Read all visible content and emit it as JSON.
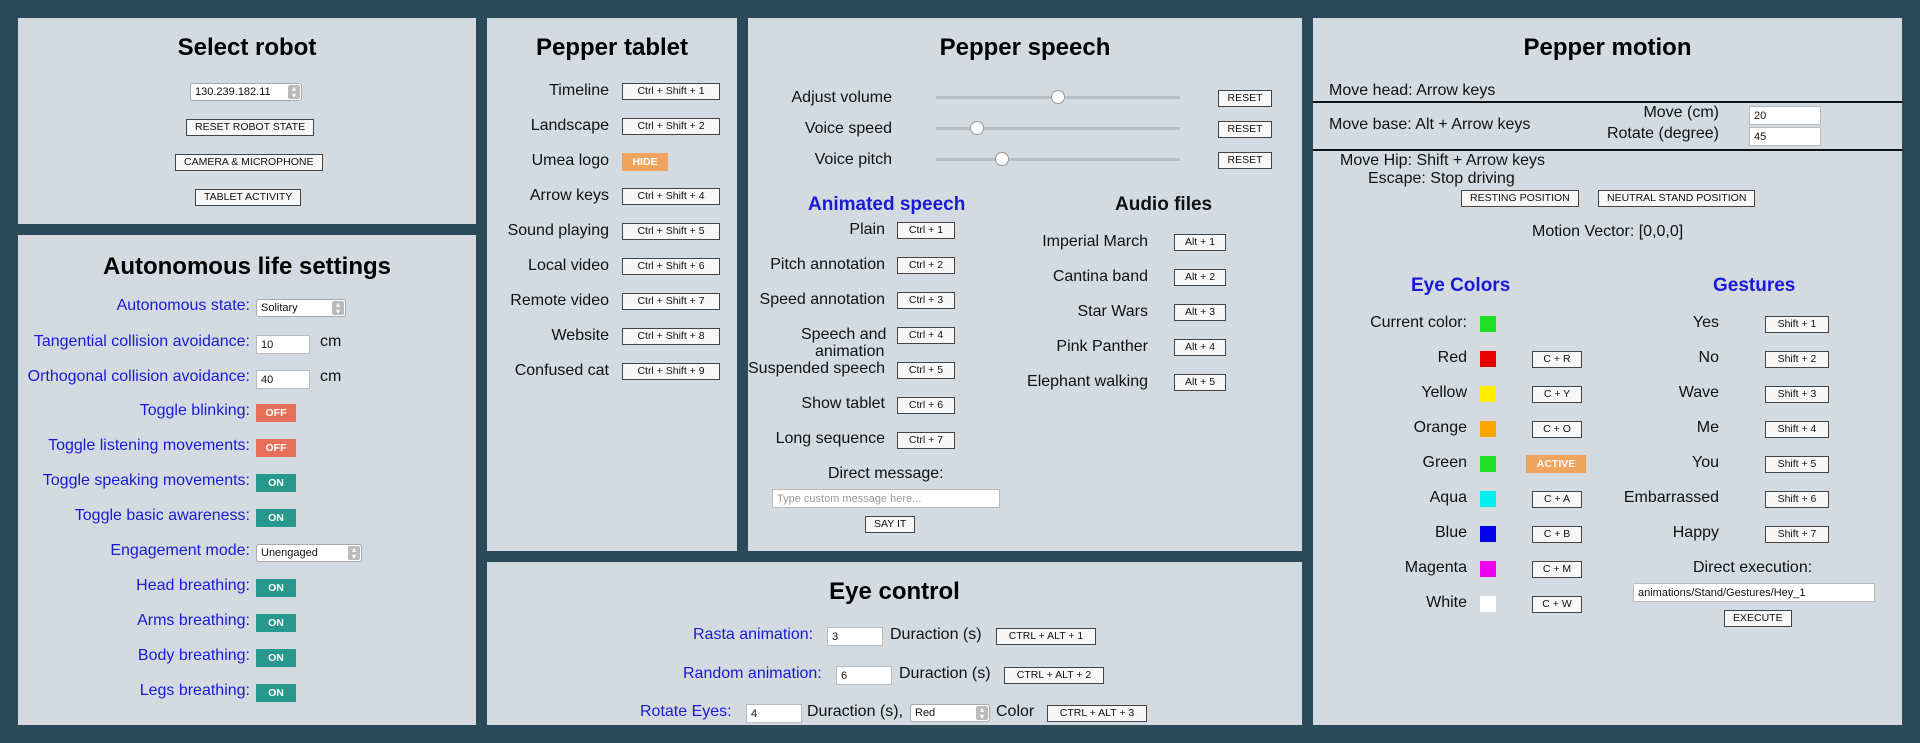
{
  "select_robot": {
    "title": "Select robot",
    "ip": "130.239.182.11",
    "buttons": [
      "RESET ROBOT STATE",
      "CAMERA & MICROPHONE",
      "TABLET ACTIVITY"
    ]
  },
  "autonomous": {
    "title": "Autonomous life settings",
    "state_label": "Autonomous state:",
    "state_value": "Solitary",
    "tangential_label": "Tangential collision avoidance:",
    "tangential_value": "10",
    "orthogonal_label": "Orthogonal collision avoidance:",
    "orthogonal_value": "40",
    "unit": "cm",
    "toggles": [
      {
        "label": "Toggle blinking:",
        "state": "OFF"
      },
      {
        "label": "Toggle listening movements:",
        "state": "OFF"
      },
      {
        "label": "Toggle speaking movements:",
        "state": "ON"
      },
      {
        "label": "Toggle basic awareness:",
        "state": "ON"
      }
    ],
    "engagement_label": "Engagement mode:",
    "engagement_value": "Unengaged",
    "breathing": [
      {
        "label": "Head breathing:",
        "state": "ON"
      },
      {
        "label": "Arms breathing:",
        "state": "ON"
      },
      {
        "label": "Body breathing:",
        "state": "ON"
      },
      {
        "label": "Legs breathing:",
        "state": "ON"
      }
    ]
  },
  "tablet": {
    "title": "Pepper tablet",
    "items": [
      {
        "label": "Timeline",
        "key": "Ctrl + Shift + 1"
      },
      {
        "label": "Landscape",
        "key": "Ctrl + Shift + 2"
      },
      {
        "label": "Umea logo",
        "key": "HIDE"
      },
      {
        "label": "Arrow keys",
        "key": "Ctrl + Shift + 4"
      },
      {
        "label": "Sound playing",
        "key": "Ctrl + Shift + 5"
      },
      {
        "label": "Local video",
        "key": "Ctrl + Shift + 6"
      },
      {
        "label": "Remote video",
        "key": "Ctrl + Shift + 7"
      },
      {
        "label": "Website",
        "key": "Ctrl + Shift + 8"
      },
      {
        "label": "Confused cat",
        "key": "Ctrl + Shift + 9"
      }
    ]
  },
  "speech": {
    "title": "Pepper speech",
    "sliders": [
      {
        "label": "Adjust volume",
        "value": 0.5,
        "reset": "RESET"
      },
      {
        "label": "Voice speed",
        "value": 0.17,
        "reset": "RESET"
      },
      {
        "label": "Voice pitch",
        "value": 0.27,
        "reset": "RESET"
      }
    ],
    "animated_title": "Animated speech",
    "animated": [
      {
        "label": "Plain",
        "key": "Ctrl + 1"
      },
      {
        "label": "Pitch annotation",
        "key": "Ctrl + 2"
      },
      {
        "label": "Speed annotation",
        "key": "Ctrl + 3"
      },
      {
        "label": "Speech and",
        "label2": "animation",
        "key": "Ctrl + 4"
      },
      {
        "label": "Suspended speech",
        "key": "Ctrl + 5"
      },
      {
        "label": "Show tablet",
        "key": "Ctrl + 6"
      },
      {
        "label": "Long sequence",
        "key": "Ctrl + 7"
      }
    ],
    "audio_title": "Audio files",
    "audio": [
      {
        "label": "Imperial March",
        "key": "Alt + 1"
      },
      {
        "label": "Cantina band",
        "key": "Alt + 2"
      },
      {
        "label": "Star Wars",
        "key": "Alt + 3"
      },
      {
        "label": "Pink Panther",
        "key": "Alt + 4"
      },
      {
        "label": "Elephant walking",
        "key": "Alt + 5"
      }
    ],
    "direct_label": "Direct message:",
    "direct_placeholder": "Type custom message here...",
    "say_button": "SAY IT"
  },
  "eye": {
    "title": "Eye control",
    "rasta_label": "Rasta animation:",
    "rasta_value": "3",
    "random_label": "Random animation:",
    "random_value": "6",
    "rotate_label": "Rotate Eyes:",
    "rotate_value": "4",
    "duration_label": "Duraction (s)",
    "duration_label2": "Duraction (s),",
    "rotate_color": "Red",
    "color_label": "Color",
    "keys": [
      "CTRL + ALT + 1",
      "CTRL + ALT + 2",
      "CTRL + ALT + 3"
    ]
  },
  "motion": {
    "title": "Pepper motion",
    "move_head_label": "Move head",
    "move_head_value": "Arrow keys",
    "move_base_label": "Move base",
    "move_base_value": "Alt + Arrow keys",
    "move_cm_label": "Move (cm)",
    "move_cm_value": "20",
    "rotate_label": "Rotate (degree)",
    "rotate_value": "45",
    "move_hip_label": "Move Hip",
    "move_hip_value": "Shift + Arrow keys",
    "escape_label": "Escape",
    "escape_value": "Stop driving",
    "resting_button": "RESTING POSITION",
    "neutral_button": "NEUTRAL STAND POSITION",
    "motion_vector": "Motion Vector: [0,0,0]",
    "eye_colors_title": "Eye Colors",
    "current_color_label": "Current color:",
    "current_color": "#22dd22",
    "colors": [
      {
        "label": "Red",
        "hex": "#e80000",
        "key": "C + R"
      },
      {
        "label": "Yellow",
        "hex": "#ffee00",
        "key": "C + Y"
      },
      {
        "label": "Orange",
        "hex": "#ffa500",
        "key": "C + O"
      },
      {
        "label": "Green",
        "hex": "#22dd22",
        "key": "ACTIVE"
      },
      {
        "label": "Aqua",
        "hex": "#00f0f0",
        "key": "C + A"
      },
      {
        "label": "Blue",
        "hex": "#0000e8",
        "key": "C + B"
      },
      {
        "label": "Magenta",
        "hex": "#ee00ee",
        "key": "C + M"
      },
      {
        "label": "White",
        "hex": "#ffffff",
        "key": "C + W"
      }
    ],
    "gestures_title": "Gestures",
    "gestures": [
      {
        "label": "Yes",
        "key": "Shift + 1"
      },
      {
        "label": "No",
        "key": "Shift + 2"
      },
      {
        "label": "Wave",
        "key": "Shift + 3"
      },
      {
        "label": "Me",
        "key": "Shift + 4"
      },
      {
        "label": "You",
        "key": "Shift + 5"
      },
      {
        "label": "Embarrassed",
        "key": "Shift + 6"
      },
      {
        "label": "Happy",
        "key": "Shift + 7"
      }
    ],
    "direct_exec_label": "Direct execution:",
    "direct_exec_value": "animations/Stand/Gestures/Hey_1",
    "execute_button": "EXECUTE"
  }
}
